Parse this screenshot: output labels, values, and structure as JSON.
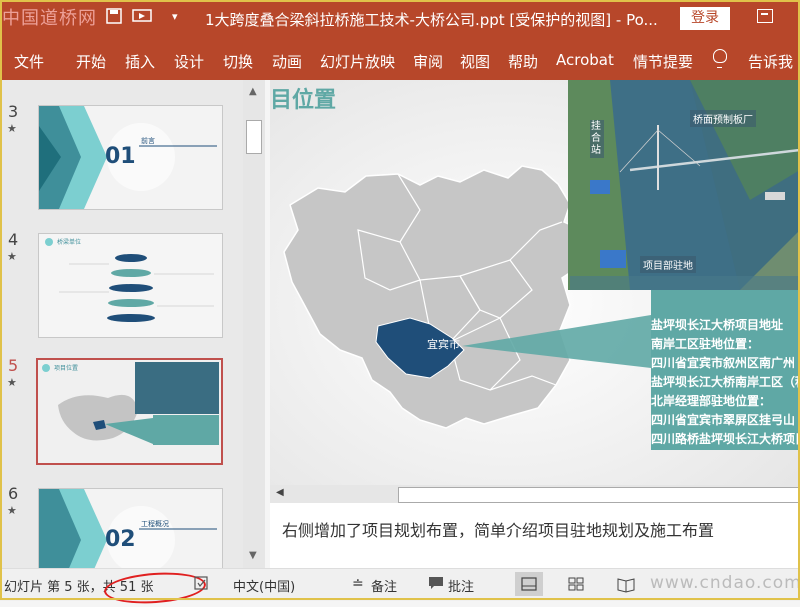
{
  "titlebar": {
    "watermark": "中国道桥网",
    "title": "1大跨度叠合梁斜拉桥施工技术-大桥公司.ppt [受保护的视图]  -  Po...",
    "login_label": "登录",
    "quick_access": [
      "save-icon",
      "undo-icon",
      "redo-icon",
      "present-icon",
      "customize-icon"
    ]
  },
  "ribbon": {
    "tabs": [
      "文件",
      "开始",
      "插入",
      "设计",
      "切换",
      "动画",
      "幻灯片放映",
      "审阅",
      "视图",
      "帮助",
      "Acrobat",
      "情节提要"
    ],
    "tell_me": "告诉我"
  },
  "thumbnails": [
    {
      "number": "3",
      "section_num": "01",
      "section_title": "前言"
    },
    {
      "number": "4",
      "header": "桥梁单位"
    },
    {
      "number": "5",
      "header": "项目位置",
      "selected": true
    },
    {
      "number": "6",
      "section_num": "02",
      "section_title": "工程概况"
    }
  ],
  "slide": {
    "title_fragment": "目位置",
    "photo_label_1": "桥面预制板厂",
    "photo_label_2": "项目部驻地",
    "photo_label_3": "挂合站",
    "map_label": "宜宾市",
    "info_lines": [
      "盐坪坝长江大桥项目地址",
      "南岸工区驻地位置：",
      "四川省宜宾市叙州区南广州",
      "盐坪坝长江大桥南岸工区（积",
      "北岸经理部驻地位置：",
      "四川省宜宾市翠屏区挂弓山",
      "四川路桥盐坪坝长江大桥项目"
    ]
  },
  "notes": {
    "text": "右侧增加了项目规划布置，简单介绍项目驻地规划及施工布置"
  },
  "statusbar": {
    "slide_info": "幻灯片 第 5 张，共 51 张",
    "language": "中文(中国)",
    "notes_label": "备注",
    "comments_label": "批注",
    "watermark": "www.cndao.com"
  },
  "colors": {
    "accent": "#b7472a",
    "teal": "#5fa8a5",
    "map_highlight": "#1f4e79"
  }
}
